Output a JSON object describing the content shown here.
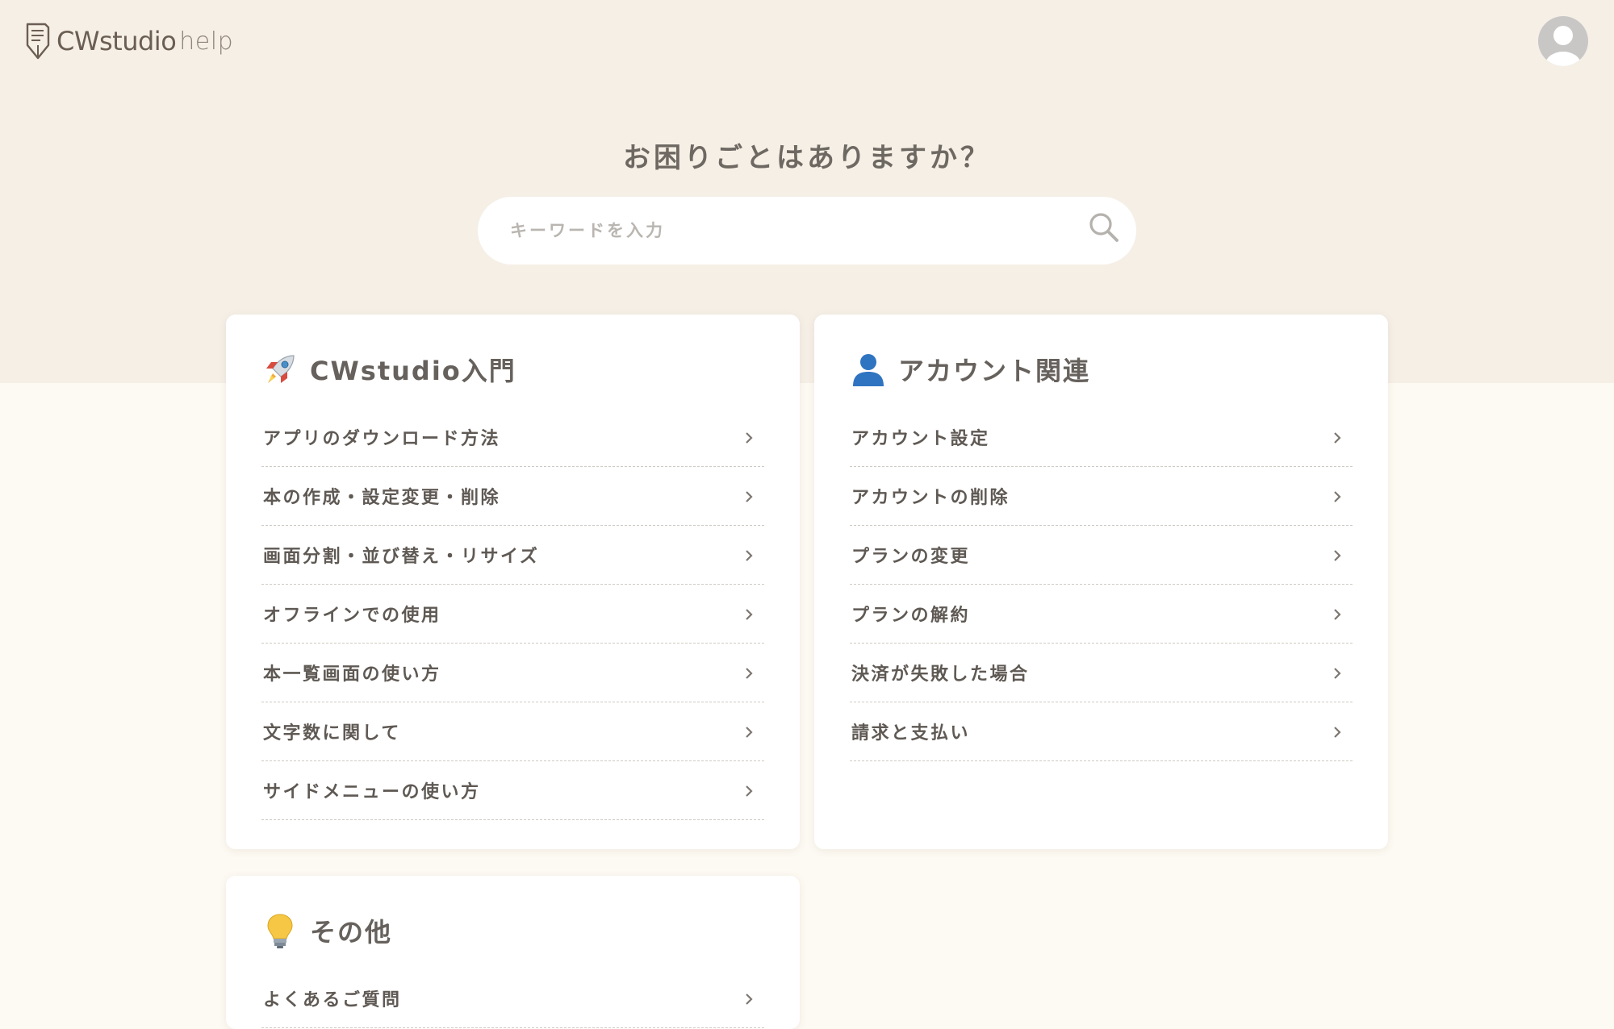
{
  "header": {
    "brand": "CWstudio",
    "brand_suffix": "help",
    "logo_icon": "pen-document-icon",
    "avatar_icon": "user-avatar-icon"
  },
  "hero": {
    "title": "お困りごとはありますか？",
    "search_placeholder": "キーワードを入力",
    "search_value": ""
  },
  "colors": {
    "top_band": "#f5efe6",
    "page_bg": "#fdfaf3",
    "card_bg": "#ffffff",
    "text": "#5f5954"
  },
  "cards": [
    {
      "icon": "rocket-icon",
      "title": "CWstudio入門",
      "items": [
        "アプリのダウンロード方法",
        "本の作成・設定変更・削除",
        "画面分割・並び替え・リサイズ",
        "オフラインでの使用",
        "本一覧画面の使い方",
        "文字数に関して",
        "サイドメニューの使い方"
      ]
    },
    {
      "icon": "person-icon",
      "title": "アカウント関連",
      "items": [
        "アカウント設定",
        "アカウントの削除",
        "プランの変更",
        "プランの解約",
        "決済が失敗した場合",
        "請求と支払い"
      ]
    },
    {
      "icon": "light-bulb-icon",
      "title": "その他",
      "items": [
        "よくあるご質問"
      ]
    }
  ]
}
